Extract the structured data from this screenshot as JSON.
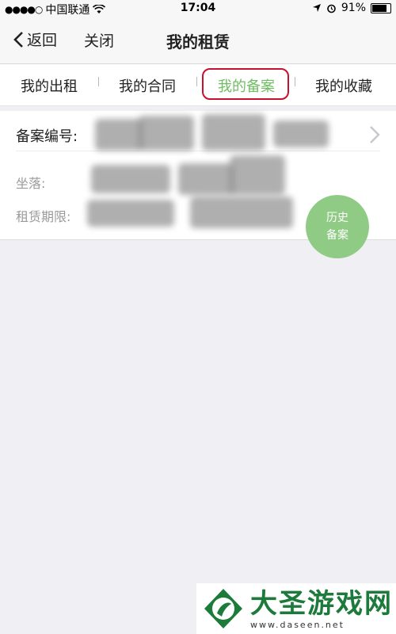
{
  "status_bar": {
    "carrier": "中国联通",
    "time": "17:04",
    "battery": "91%",
    "battery_level": 0.91
  },
  "nav": {
    "back_label": "返回",
    "close_label": "关闭",
    "title": "我的租赁"
  },
  "tabs": [
    {
      "label": "我的出租"
    },
    {
      "label": "我的合同"
    },
    {
      "label": "我的备案",
      "active": true
    },
    {
      "label": "我的收藏"
    }
  ],
  "record": {
    "number_label": "备案编号:",
    "location_label": "坐落:",
    "period_label": "租赁期限:"
  },
  "fab": {
    "line1": "历史",
    "line2": "备案"
  },
  "watermark": {
    "title": "大圣游戏网",
    "url": "www.daseen.net"
  },
  "colors": {
    "accent": "#6fbd63",
    "fab": "#8fcb84",
    "highlight_ring": "#c8102e"
  }
}
